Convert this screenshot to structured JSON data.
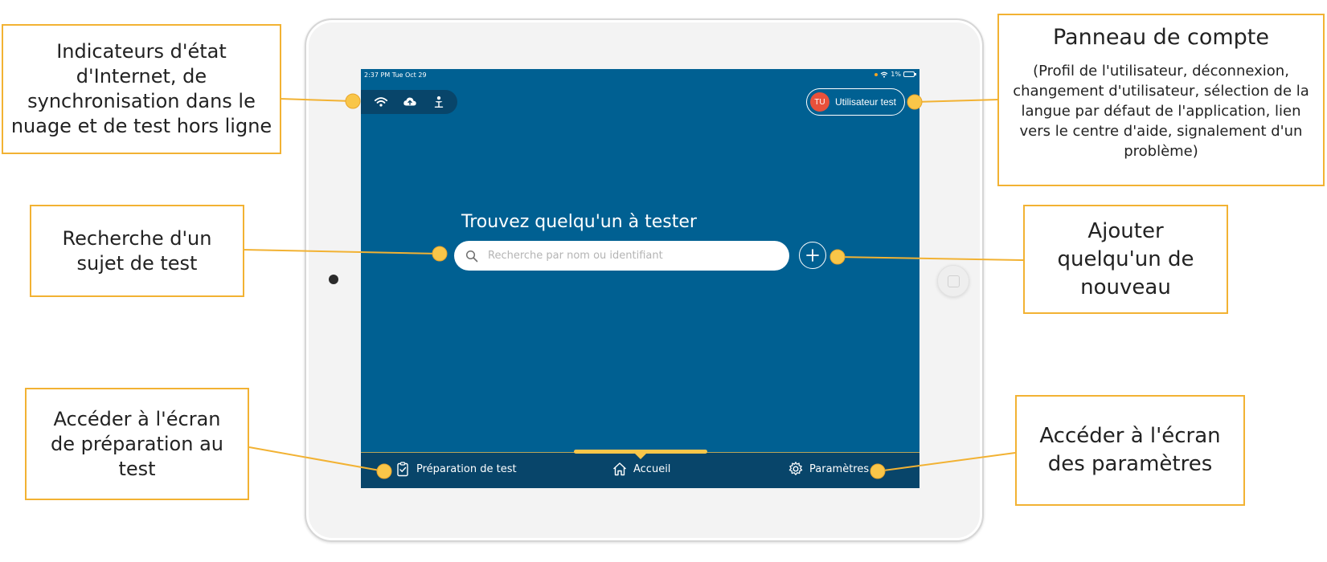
{
  "device": {
    "status_bar": {
      "time": "2:37 PM  Tue Oct 29",
      "battery": "1%"
    },
    "account_button": {
      "initials": "TU",
      "label": "Utilisateur test"
    },
    "indicators": {
      "icons": [
        "wifi-icon",
        "cloud-sync-icon",
        "offline-test-icon"
      ]
    },
    "search": {
      "title": "Trouvez quelqu'un à tester",
      "placeholder": "Recherche par nom ou identifiant"
    },
    "bottom_nav": {
      "items": [
        {
          "label": "Préparation de test",
          "icon": "clipboard-check-icon"
        },
        {
          "label": "Accueil",
          "icon": "home-icon",
          "active": true
        },
        {
          "label": "Paramètres",
          "icon": "gear-icon"
        }
      ]
    },
    "colors": {
      "screen_bg": "#006092",
      "nav_bg": "#08456a",
      "accent": "#f9c649",
      "avatar": "#e8513b"
    }
  },
  "callouts": {
    "indicators": "Indicateurs d'état d'Internet, de synchronisation dans le nuage et de test hors ligne",
    "search": "Recherche d'un sujet de test",
    "prep": "Accéder à l'écran de préparation au test",
    "account": {
      "title": "Panneau de compte",
      "description": "(Profil de l'utilisateur, déconnexion, changement d'utilisateur, sélection de la langue par défaut de l'application, lien vers le centre d'aide, signalement d'un problème)"
    },
    "add": "Ajouter quelqu'un de nouveau",
    "settings": "Accéder à l'écran des paramètres"
  }
}
